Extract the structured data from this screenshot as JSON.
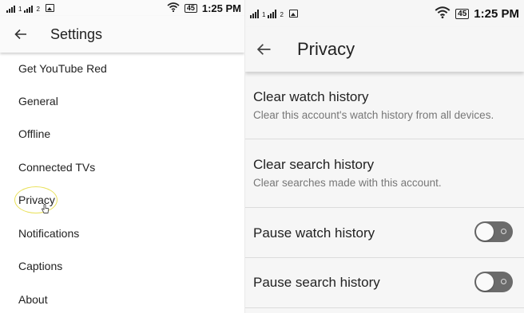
{
  "status_bar": {
    "sim1": "1",
    "sim2": "2",
    "battery": "45",
    "time": "1:25 PM"
  },
  "settings": {
    "title": "Settings",
    "items": [
      {
        "label": "Get YouTube Red"
      },
      {
        "label": "General"
      },
      {
        "label": "Offline"
      },
      {
        "label": "Connected TVs"
      },
      {
        "label": "Privacy"
      },
      {
        "label": "Notifications"
      },
      {
        "label": "Captions"
      },
      {
        "label": "About"
      }
    ]
  },
  "privacy": {
    "title": "Privacy",
    "clear_watch": {
      "title": "Clear watch history",
      "subtitle": "Clear this account's watch history from all devices."
    },
    "clear_search": {
      "title": "Clear search history",
      "subtitle": "Clear searches made with this account."
    },
    "pause_watch": {
      "label": "Pause watch history",
      "enabled": false
    },
    "pause_search": {
      "label": "Pause search history",
      "enabled": false
    }
  },
  "colors": {
    "toggle_off_track": "#6b6b6b",
    "highlight_ring": "#e9e15a",
    "secondary_text": "#777777"
  }
}
